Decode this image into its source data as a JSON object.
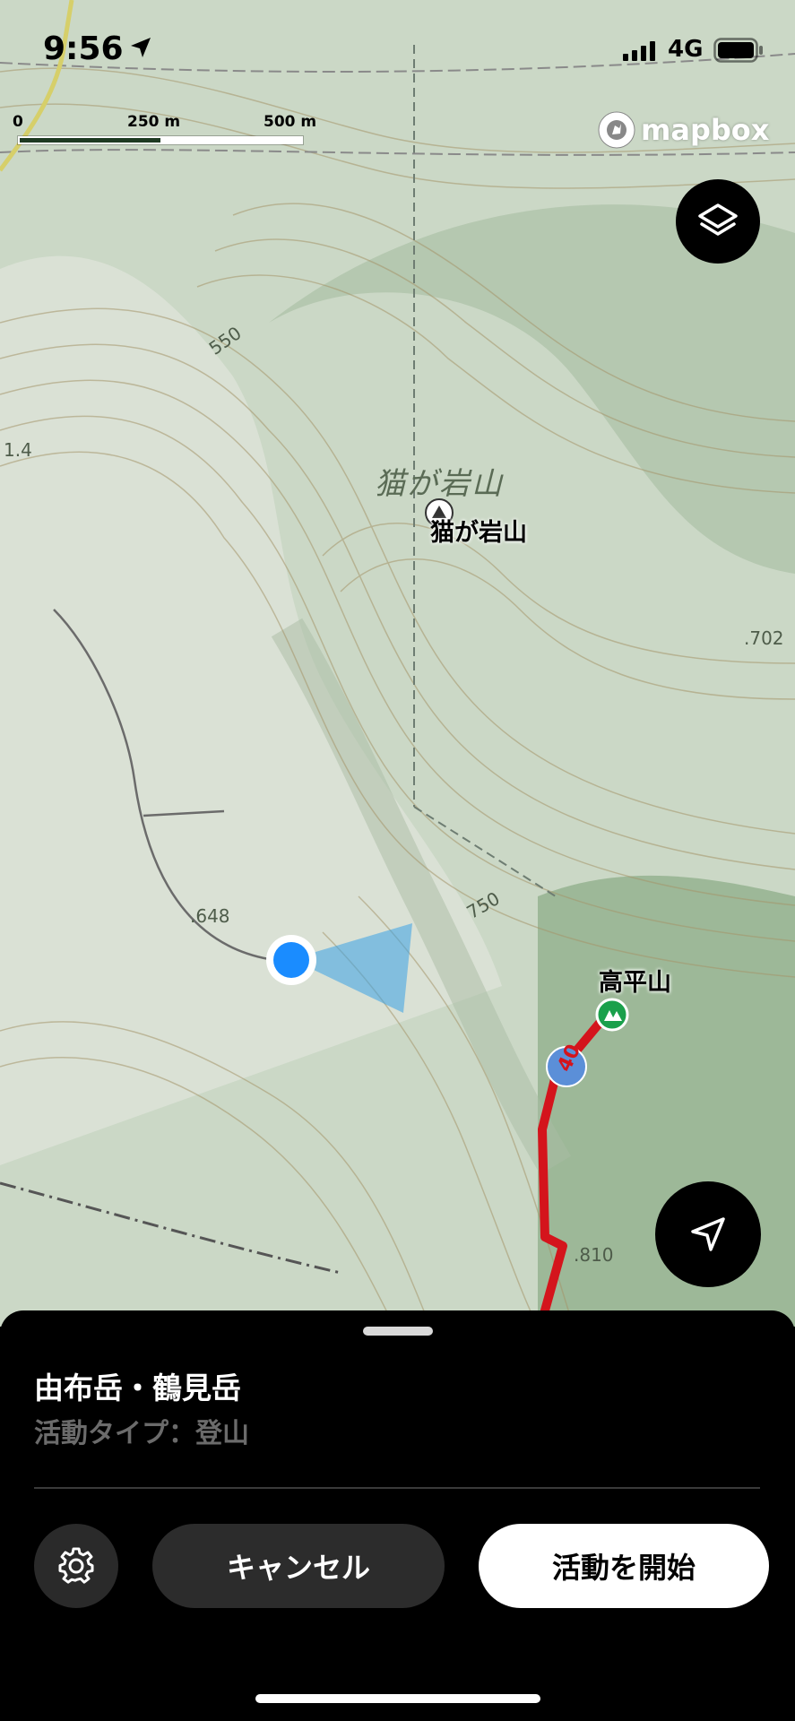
{
  "status_bar": {
    "time": "9:56",
    "network": "4G"
  },
  "map": {
    "scale": {
      "zero": "0",
      "mid": "250 m",
      "end": "500 m"
    },
    "attribution": "mapbox",
    "peaks": [
      {
        "label": "猫が岩山",
        "italic_label": "猫が岩山"
      },
      {
        "label": "高平山"
      }
    ],
    "elevations": [
      ".648",
      ".702",
      ".810",
      "550",
      "750",
      "1.4"
    ],
    "route_marker": "40",
    "colors": {
      "route": "#d4141c",
      "user_dot": "#1a8cff",
      "peak_marker": "#1aa04b"
    }
  },
  "sheet": {
    "title": "由布岳・鶴見岳",
    "subtitle": "活動タイプ：登山",
    "cancel_label": "キャンセル",
    "start_label": "活動を開始"
  }
}
